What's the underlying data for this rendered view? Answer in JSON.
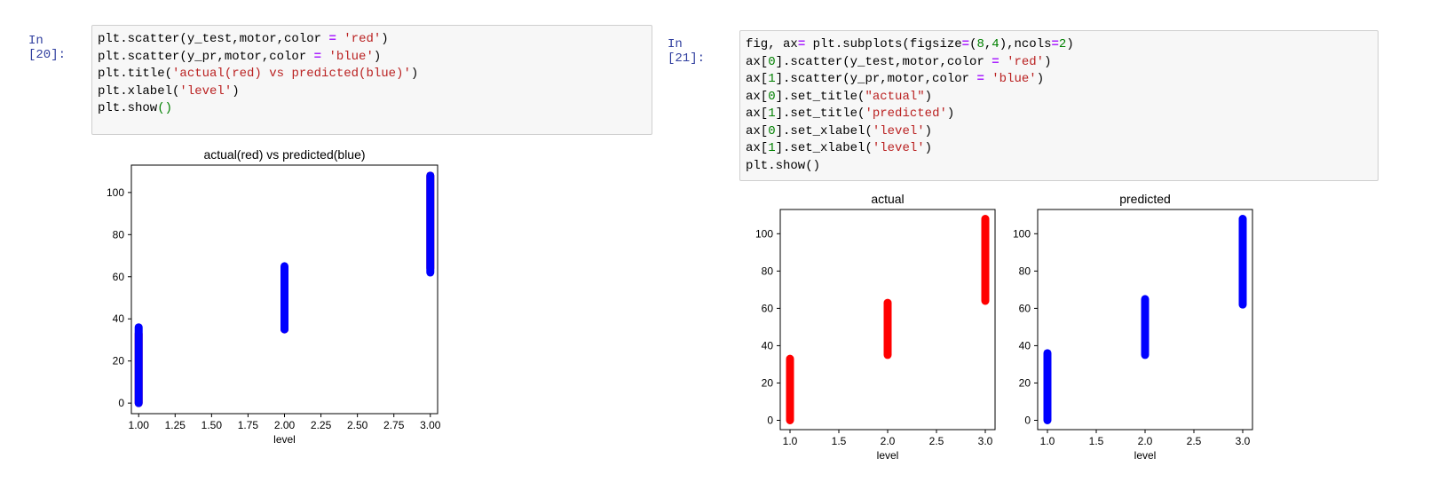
{
  "cells": [
    {
      "prompt": "In [20]:",
      "code_lines": [
        [
          [
            "p",
            "plt.scatter(y_test,motor,color "
          ],
          [
            "o",
            "="
          ],
          [
            "p",
            " "
          ],
          [
            "s",
            "'red'"
          ],
          [
            "p",
            ")"
          ]
        ],
        [
          [
            "p",
            "plt.scatter(y_pr,motor,color "
          ],
          [
            "o",
            "="
          ],
          [
            "p",
            " "
          ],
          [
            "s",
            "'blue'"
          ],
          [
            "p",
            ")"
          ]
        ],
        [
          [
            "p",
            "plt.title("
          ],
          [
            "s",
            "'actual(red) vs predicted(blue)'"
          ],
          [
            "p",
            ")"
          ]
        ],
        [
          [
            "p",
            "plt.xlabel("
          ],
          [
            "s",
            "'level'"
          ],
          [
            "p",
            ")"
          ]
        ],
        [
          [
            "p",
            "plt.show"
          ],
          [
            "n",
            "()"
          ]
        ]
      ]
    },
    {
      "prompt": "In [21]:",
      "code_lines": [
        [
          [
            "p",
            "fig, ax"
          ],
          [
            "o",
            "="
          ],
          [
            "p",
            " plt.subplots(figsize"
          ],
          [
            "o",
            "="
          ],
          [
            "p",
            "("
          ],
          [
            "n",
            "8"
          ],
          [
            "p",
            ","
          ],
          [
            "n",
            "4"
          ],
          [
            "p",
            "),ncols"
          ],
          [
            "o",
            "="
          ],
          [
            "n",
            "2"
          ],
          [
            "p",
            ")"
          ]
        ],
        [
          [
            "p",
            "ax["
          ],
          [
            "n",
            "0"
          ],
          [
            "p",
            "].scatter(y_test,motor,color "
          ],
          [
            "o",
            "="
          ],
          [
            "p",
            " "
          ],
          [
            "s",
            "'red'"
          ],
          [
            "p",
            ")"
          ]
        ],
        [
          [
            "p",
            "ax["
          ],
          [
            "n",
            "1"
          ],
          [
            "p",
            "].scatter(y_pr,motor,color "
          ],
          [
            "o",
            "="
          ],
          [
            "p",
            " "
          ],
          [
            "s",
            "'blue'"
          ],
          [
            "p",
            ")"
          ]
        ],
        [
          [
            "p",
            "ax["
          ],
          [
            "n",
            "0"
          ],
          [
            "p",
            "].set_title("
          ],
          [
            "s",
            "\"actual\""
          ],
          [
            "p",
            ")"
          ]
        ],
        [
          [
            "p",
            "ax["
          ],
          [
            "n",
            "1"
          ],
          [
            "p",
            "].set_title("
          ],
          [
            "s",
            "'predicted'"
          ],
          [
            "p",
            ")"
          ]
        ],
        [
          [
            "p",
            "ax["
          ],
          [
            "n",
            "0"
          ],
          [
            "p",
            "].set_xlabel("
          ],
          [
            "s",
            "'level'"
          ],
          [
            "p",
            ")"
          ]
        ],
        [
          [
            "p",
            "ax["
          ],
          [
            "n",
            "1"
          ],
          [
            "p",
            "].set_xlabel("
          ],
          [
            "s",
            "'level'"
          ],
          [
            "p",
            ")"
          ]
        ],
        [
          [
            "p",
            "plt.show()"
          ]
        ]
      ]
    }
  ],
  "chart_data": [
    {
      "type": "scatter",
      "title": "actual(red) vs predicted(blue)",
      "xlabel": "level",
      "ylabel": "",
      "xlim": [
        0.95,
        3.05
      ],
      "ylim": [
        -5,
        113
      ],
      "xticks": [
        1.0,
        1.25,
        1.5,
        1.75,
        2.0,
        2.25,
        2.5,
        2.75,
        3.0
      ],
      "xtick_labels": [
        "1.00",
        "1.25",
        "1.50",
        "1.75",
        "2.00",
        "2.25",
        "2.50",
        "2.75",
        "3.00"
      ],
      "yticks": [
        0,
        20,
        40,
        60,
        80,
        100
      ],
      "series": [
        {
          "color": "#ff0000",
          "points": [
            [
              1,
              0
            ],
            [
              1,
              33
            ],
            [
              2,
              35
            ],
            [
              2,
              63
            ],
            [
              3,
              64
            ],
            [
              3,
              108
            ]
          ]
        },
        {
          "color": "#0000ff",
          "points": [
            [
              1,
              0
            ],
            [
              1,
              36
            ],
            [
              2,
              35
            ],
            [
              2,
              65
            ],
            [
              3,
              62
            ],
            [
              3,
              108
            ]
          ]
        }
      ]
    },
    {
      "type": "scatter",
      "title": "actual",
      "xlabel": "level",
      "ylabel": "",
      "xlim": [
        0.9,
        3.1
      ],
      "ylim": [
        -5,
        113
      ],
      "xticks": [
        1.0,
        1.5,
        2.0,
        2.5,
        3.0
      ],
      "xtick_labels": [
        "1.0",
        "1.5",
        "2.0",
        "2.5",
        "3.0"
      ],
      "yticks": [
        0,
        20,
        40,
        60,
        80,
        100
      ],
      "series": [
        {
          "color": "#ff0000",
          "points": [
            [
              1,
              0
            ],
            [
              1,
              33
            ],
            [
              2,
              35
            ],
            [
              2,
              63
            ],
            [
              3,
              64
            ],
            [
              3,
              108
            ]
          ]
        }
      ]
    },
    {
      "type": "scatter",
      "title": "predicted",
      "xlabel": "level",
      "ylabel": "",
      "xlim": [
        0.9,
        3.1
      ],
      "ylim": [
        -5,
        113
      ],
      "xticks": [
        1.0,
        1.5,
        2.0,
        2.5,
        3.0
      ],
      "xtick_labels": [
        "1.0",
        "1.5",
        "2.0",
        "2.5",
        "3.0"
      ],
      "yticks": [
        0,
        20,
        40,
        60,
        80,
        100
      ],
      "series": [
        {
          "color": "#0000ff",
          "points": [
            [
              1,
              0
            ],
            [
              1,
              36
            ],
            [
              2,
              35
            ],
            [
              2,
              65
            ],
            [
              3,
              62
            ],
            [
              3,
              108
            ]
          ]
        }
      ]
    }
  ]
}
